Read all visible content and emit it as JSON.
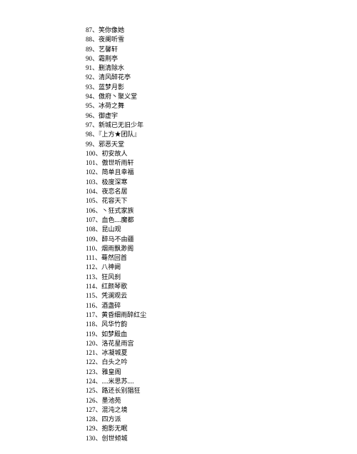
{
  "items": [
    {
      "num": "87",
      "text": "笑你像她"
    },
    {
      "num": "88",
      "text": "夜阑听雪"
    },
    {
      "num": "89",
      "text": "艺馨轩"
    },
    {
      "num": "90",
      "text": "霜荆亭"
    },
    {
      "num": "91",
      "text": "删清除水"
    },
    {
      "num": "92",
      "text": "清风醉花亭"
    },
    {
      "num": "93",
      "text": "蓝梦月影"
    },
    {
      "num": "94",
      "text": "傲府丶聚义堂"
    },
    {
      "num": "95",
      "text": "冰荷之舞"
    },
    {
      "num": "96",
      "text": "御虚宇"
    },
    {
      "num": "97",
      "text": "新城已无旧少年"
    },
    {
      "num": "98",
      "text": "『上方★团队』"
    },
    {
      "num": "99",
      "text": "邪恶天堂"
    },
    {
      "num": "100",
      "text": "初安故人"
    },
    {
      "num": "101",
      "text": "傲世听雨轩"
    },
    {
      "num": "102",
      "text": "简单且幸福"
    },
    {
      "num": "103",
      "text": "极度深寒"
    },
    {
      "num": "104",
      "text": "夜恋名居"
    },
    {
      "num": "105",
      "text": "花容天下"
    },
    {
      "num": "106",
      "text": "丶狂式家族"
    },
    {
      "num": "107",
      "text": "血色....魔都"
    },
    {
      "num": "108",
      "text": "昆山观"
    },
    {
      "num": "109",
      "text": "醉马不由疆"
    },
    {
      "num": "110",
      "text": "烟雨飘渺阁"
    },
    {
      "num": "111",
      "text": "蓦然回首"
    },
    {
      "num": "112",
      "text": "八神阙"
    },
    {
      "num": "113",
      "text": "狂风刹"
    },
    {
      "num": "114",
      "text": "红颜琴歌"
    },
    {
      "num": "115",
      "text": "凭澜观云"
    },
    {
      "num": "116",
      "text": "酒盏碎"
    },
    {
      "num": "117",
      "text": "黄昏细雨醉红尘"
    },
    {
      "num": "118",
      "text": "风华竹韵"
    },
    {
      "num": "119",
      "text": "如梦殿血"
    },
    {
      "num": "120",
      "text": "洛花星雨宫"
    },
    {
      "num": "121",
      "text": "冰凝城夏"
    },
    {
      "num": "122",
      "text": "白头之吟"
    },
    {
      "num": "123",
      "text": "雅皇阁"
    },
    {
      "num": "124",
      "text": "....米思苏...."
    },
    {
      "num": "125",
      "text": "路还长别猖狂"
    },
    {
      "num": "126",
      "text": "墨池苑"
    },
    {
      "num": "127",
      "text": "混沌之境"
    },
    {
      "num": "128",
      "text": "四方派"
    },
    {
      "num": "129",
      "text": "抱影无眠"
    },
    {
      "num": "130",
      "text": "创世倾城"
    }
  ],
  "separator": "、"
}
